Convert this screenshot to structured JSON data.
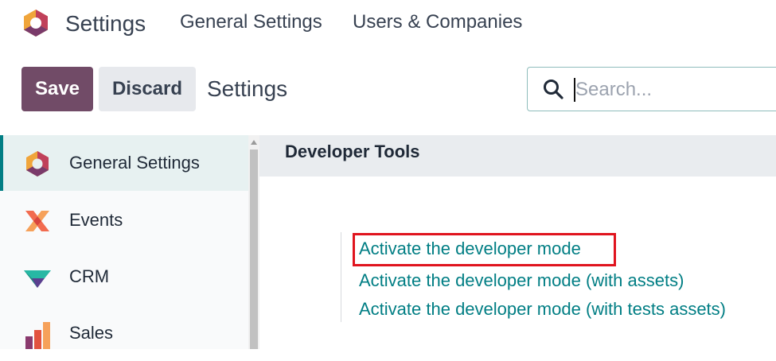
{
  "navbar": {
    "app_title": "Settings",
    "menu": [
      "General Settings",
      "Users & Companies"
    ]
  },
  "control_panel": {
    "save_label": "Save",
    "discard_label": "Discard",
    "breadcrumb": "Settings",
    "search_placeholder": "Search..."
  },
  "sidebar": {
    "items": [
      {
        "label": "General Settings",
        "icon": "settings-hexagon-icon",
        "active": true
      },
      {
        "label": "Events",
        "icon": "events-icon",
        "active": false
      },
      {
        "label": "CRM",
        "icon": "crm-icon",
        "active": false
      },
      {
        "label": "Sales",
        "icon": "sales-icon",
        "active": false
      }
    ]
  },
  "main": {
    "section_title": "Developer Tools",
    "links": [
      "Activate the developer mode",
      "Activate the developer mode (with assets)",
      "Activate the developer mode (with tests assets)"
    ],
    "highlighted_link_index": 0
  },
  "colors": {
    "brand": "#714b67",
    "link": "#017e84",
    "highlight": "#e0141e"
  }
}
